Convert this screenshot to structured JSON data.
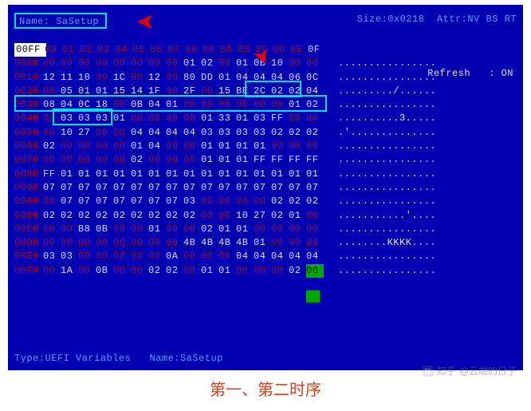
{
  "header": {
    "name_label": "Name: ",
    "name_value": "SaSetup",
    "size_label": "Size:",
    "size_value": "0x0218",
    "attr_label": "Attr:",
    "attr_value": "NV BS RT"
  },
  "side": {
    "refresh_label": "Refresh",
    "refresh_sep": ": ",
    "refresh_value": "ON"
  },
  "header_offset": "00FF",
  "columns": [
    "00",
    "01",
    "02",
    "03",
    "04",
    "05",
    "06",
    "07",
    "08",
    "09",
    "0A",
    "0B",
    "0C",
    "0D",
    "0E",
    "0F"
  ],
  "rows": [
    {
      "off": "0000",
      "hex": [
        "00",
        "00",
        "00",
        "00",
        "00",
        "00",
        "00",
        "00",
        "01",
        "02",
        "00",
        "01",
        "0B",
        "10",
        "00",
        "00"
      ],
      "red": [
        0,
        1,
        2,
        3,
        4,
        5,
        6,
        7,
        10,
        14,
        15
      ],
      "ascii": "................"
    },
    {
      "off": "0010",
      "hex": [
        "12",
        "11",
        "10",
        "00",
        "1C",
        "00",
        "12",
        "00",
        "80",
        "DD",
        "01",
        "04",
        "04",
        "04",
        "06",
        "0C"
      ],
      "red": [
        3,
        5,
        7
      ],
      "ascii": "................"
    },
    {
      "off": "0020",
      "hex": [
        "00",
        "05",
        "01",
        "01",
        "15",
        "14",
        "1F",
        "00",
        "2F",
        "00",
        "15",
        "BE",
        "2C",
        "02",
        "02",
        "04"
      ],
      "red": [
        0,
        7,
        9
      ],
      "ascii": "........./......"
    },
    {
      "off": "0030",
      "hex": [
        "08",
        "04",
        "0C",
        "18",
        "00",
        "0B",
        "04",
        "01",
        "00",
        "00",
        "00",
        "00",
        "00",
        "00",
        "01",
        "02"
      ],
      "red": [
        4,
        8,
        9,
        10,
        11,
        12,
        13
      ],
      "ascii": "................"
    },
    {
      "off": "0040",
      "hex": [
        "00",
        "03",
        "03",
        "03",
        "01",
        "00",
        "00",
        "00",
        "00",
        "01",
        "33",
        "01",
        "03",
        "FF",
        "00",
        "00"
      ],
      "red": [
        0,
        5,
        6,
        7,
        8,
        14,
        15
      ],
      "ascii": "..........3....."
    },
    {
      "off": "0050",
      "hex": [
        "00",
        "10",
        "27",
        "00",
        "00",
        "04",
        "04",
        "04",
        "04",
        "03",
        "03",
        "03",
        "03",
        "02",
        "02",
        "02"
      ],
      "red": [
        0,
        3,
        4
      ],
      "ascii": ".'.............."
    },
    {
      "off": "0060",
      "hex": [
        "02",
        "00",
        "00",
        "00",
        "00",
        "01",
        "04",
        "00",
        "00",
        "01",
        "01",
        "01",
        "01",
        "00",
        "00",
        "00"
      ],
      "red": [
        1,
        2,
        3,
        4,
        7,
        8,
        13,
        14,
        15
      ],
      "ascii": "................"
    },
    {
      "off": "0070",
      "hex": [
        "00",
        "00",
        "00",
        "00",
        "00",
        "02",
        "00",
        "00",
        "00",
        "01",
        "01",
        "01",
        "FF",
        "FF",
        "FF",
        "FF"
      ],
      "red": [
        0,
        1,
        2,
        3,
        4,
        6,
        7,
        8
      ],
      "ascii": "................"
    },
    {
      "off": "0080",
      "hex": [
        "FF",
        "01",
        "01",
        "01",
        "01",
        "01",
        "01",
        "01",
        "01",
        "01",
        "01",
        "01",
        "01",
        "01",
        "01",
        "01"
      ],
      "red": [],
      "ascii": "................"
    },
    {
      "off": "0090",
      "hex": [
        "07",
        "07",
        "07",
        "07",
        "07",
        "07",
        "07",
        "07",
        "07",
        "07",
        "07",
        "07",
        "07",
        "07",
        "07",
        "07"
      ],
      "red": [],
      "ascii": "................"
    },
    {
      "off": "00A0",
      "hex": [
        "00",
        "07",
        "07",
        "07",
        "07",
        "07",
        "07",
        "07",
        "03",
        "00",
        "00",
        "00",
        "00",
        "02",
        "02",
        "02"
      ],
      "red": [
        0,
        9,
        10,
        11,
        12
      ],
      "ascii": "................"
    },
    {
      "off": "00B0",
      "hex": [
        "02",
        "02",
        "02",
        "02",
        "02",
        "02",
        "02",
        "02",
        "02",
        "00",
        "00",
        "10",
        "27",
        "02",
        "01",
        "00"
      ],
      "red": [
        9,
        10,
        15
      ],
      "ascii": "...........'...."
    },
    {
      "off": "00C0",
      "hex": [
        "00",
        "00",
        "B8",
        "0B",
        "00",
        "00",
        "01",
        "00",
        "00",
        "02",
        "01",
        "01",
        "00",
        "00",
        "00",
        "00"
      ],
      "red": [
        0,
        1,
        4,
        5,
        7,
        8,
        12,
        13,
        14,
        15
      ],
      "ascii": "................"
    },
    {
      "off": "00D0",
      "hex": [
        "00",
        "00",
        "00",
        "00",
        "00",
        "00",
        "00",
        "00",
        "4B",
        "4B",
        "4B",
        "4B",
        "01",
        "00",
        "00",
        "00"
      ],
      "red": [
        0,
        1,
        2,
        3,
        4,
        5,
        6,
        7,
        13,
        14,
        15
      ],
      "ascii": "........KKKK...."
    },
    {
      "off": "00E0",
      "hex": [
        "03",
        "03",
        "00",
        "00",
        "00",
        "00",
        "00",
        "0A",
        "00",
        "00",
        "00",
        "04",
        "04",
        "04",
        "04",
        "04"
      ],
      "red": [
        2,
        3,
        4,
        5,
        6,
        8,
        9,
        10
      ],
      "ascii": "................"
    },
    {
      "off": "00F0",
      "hex": [
        "00",
        "1A",
        "00",
        "0B",
        "00",
        "00",
        "02",
        "02",
        "00",
        "01",
        "01",
        "00",
        "00",
        "00",
        "02",
        "00"
      ],
      "red": [
        0,
        2,
        4,
        5,
        8,
        11,
        12,
        13
      ],
      "ascii": "................"
    }
  ],
  "green_cell": {
    "row": 15,
    "col": 15
  },
  "footer": {
    "type_label": "Type:",
    "type_value": "UEFI Variables",
    "name_label": "Name:",
    "name_value": "SaSetup"
  },
  "caption": "第一、第二时序",
  "watermark": {
    "brand": "知乎",
    "user": "@云端的日子"
  }
}
